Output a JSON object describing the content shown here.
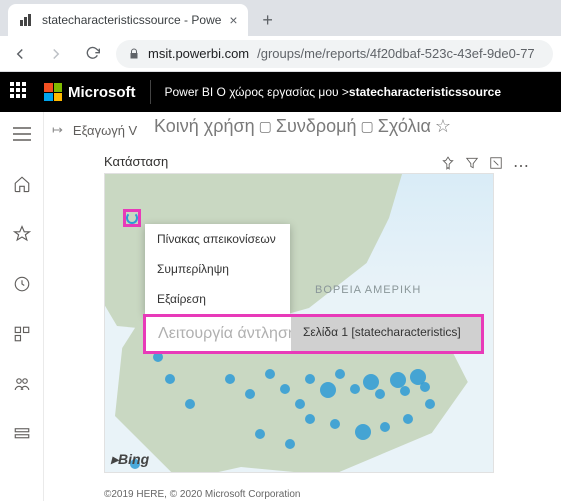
{
  "browser": {
    "tab_title": "statecharacteristicssource - Powe",
    "url_host": "msit.powerbi.com",
    "url_path": "/groups/me/reports/4f20dbaf-523c-43ef-9de0-77"
  },
  "header": {
    "brand": "Microsoft",
    "service": "Power BI",
    "workspace_prefix": "Ο χώρος εργασίας μου",
    "report_name": "statecharacteristicssource"
  },
  "toolbar": {
    "export": "Εξαγωγή V",
    "title_parts": {
      "share": "Κοινή χρήση",
      "subscribe": "Συνδρομή",
      "comments": "Σχόλια"
    }
  },
  "section": {
    "label": "Κατάσταση"
  },
  "map": {
    "region_label": "ΒΟΡΕΙΑ ΑΜΕΡΙΚΗ",
    "provider": "Bing",
    "copyright": "©2019 HERE, © 2020 Microsoft Corporation"
  },
  "context_menu": {
    "items": [
      "Πίνακας απεικονίσεων",
      "Συμπερίληψη",
      "Εξαίρεση"
    ],
    "drill_label": "Λειτουργία άντλησης",
    "submenu_label": "Σελίδα 1 [statecharacteristics]"
  }
}
